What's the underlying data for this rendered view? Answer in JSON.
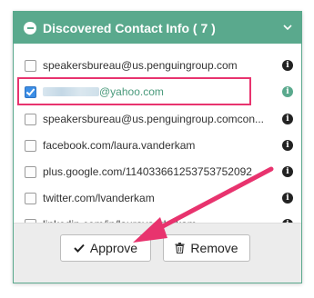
{
  "panel": {
    "title": "Discovered Contact Info ( 7 )",
    "accent_color": "#5aa98d",
    "highlight_color": "#e8336e",
    "collapse_icon": "minus-circle-icon",
    "chevron_icon": "chevron-down-icon"
  },
  "contacts": [
    {
      "text": "speakersbureau@us.penguingroup.com",
      "checked": false
    },
    {
      "text": "@yahoo.com",
      "checked": true
    },
    {
      "text": "speakersbureau@us.penguingroup.comcon...",
      "checked": false
    },
    {
      "text": "facebook.com/laura.vanderkam",
      "checked": false
    },
    {
      "text": "plus.google.com/114033661253753752092",
      "checked": false
    },
    {
      "text": "twitter.com/lvanderkam",
      "checked": false
    },
    {
      "text": "linkedin.com/in/lauravanderkam",
      "checked": false
    }
  ],
  "info_icon": "i",
  "buttons": {
    "approve_label": "Approve",
    "approve_icon": "check-icon",
    "remove_label": "Remove",
    "remove_icon": "trash-icon"
  }
}
